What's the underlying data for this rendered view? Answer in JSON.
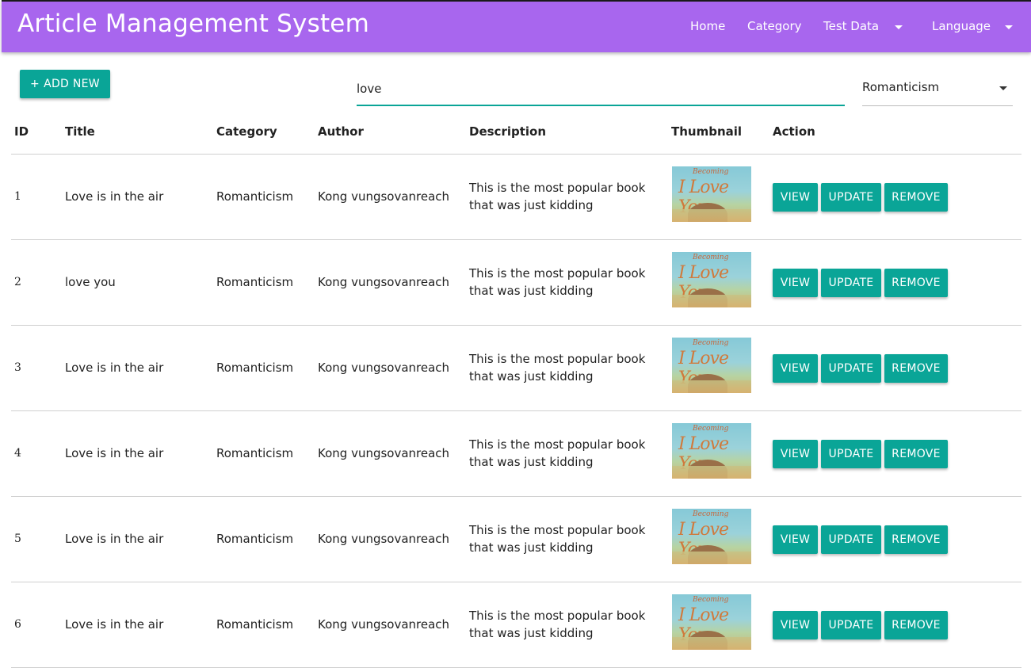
{
  "app": {
    "title": "Article Management System",
    "accent_color": "#a866ee",
    "action_color": "#0aa597"
  },
  "nav": {
    "home": "Home",
    "category": "Category",
    "test_data": "Test Data",
    "language": "Language"
  },
  "toolbar": {
    "add_plus": "+",
    "add_label": "ADD NEW",
    "search_value": "love",
    "category_filter": "Romanticism"
  },
  "table": {
    "headers": {
      "id": "ID",
      "title": "Title",
      "category": "Category",
      "author": "Author",
      "description": "Description",
      "thumbnail": "Thumbnail",
      "action": "Action"
    },
    "thumbnail_text": {
      "line1": "Becoming",
      "line2": "I Love You"
    },
    "actions": {
      "view": "VIEW",
      "update": "UPDATE",
      "remove": "REMOVE"
    },
    "rows": [
      {
        "id": "1",
        "title": "Love is in the air",
        "category": "Romanticism",
        "author": "Kong vungsovanreach",
        "description": "This is the most popular book that was just kidding"
      },
      {
        "id": "2",
        "title": "love you",
        "category": "Romanticism",
        "author": "Kong vungsovanreach",
        "description": "This is the most popular book that was just kidding"
      },
      {
        "id": "3",
        "title": "Love is in the air",
        "category": "Romanticism",
        "author": "Kong vungsovanreach",
        "description": "This is the most popular book that was just kidding"
      },
      {
        "id": "4",
        "title": "Love is in the air",
        "category": "Romanticism",
        "author": "Kong vungsovanreach",
        "description": "This is the most popular book that was just kidding"
      },
      {
        "id": "5",
        "title": "Love is in the air",
        "category": "Romanticism",
        "author": "Kong vungsovanreach",
        "description": "This is the most popular book that was just kidding"
      },
      {
        "id": "6",
        "title": "Love is in the air",
        "category": "Romanticism",
        "author": "Kong vungsovanreach",
        "description": "This is the most popular book that was just kidding"
      }
    ]
  }
}
